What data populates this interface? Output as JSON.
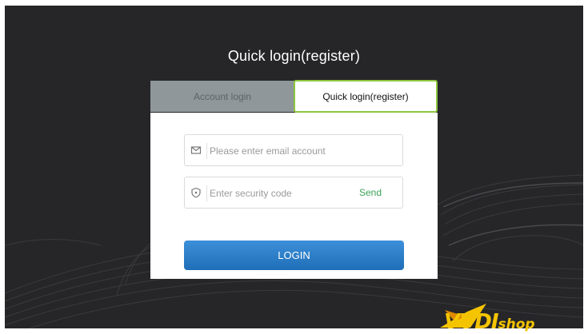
{
  "page": {
    "title": "Quick login(register)"
  },
  "tabs": [
    {
      "label": "Account login",
      "active": false
    },
    {
      "label": "Quick login(register)",
      "active": true
    }
  ],
  "form": {
    "email_placeholder": "Please enter email account",
    "email_value": "",
    "code_placeholder": "Enter security code",
    "code_value": "",
    "send_label": "Send",
    "login_label": "LOGIN"
  },
  "watermark": {
    "brand": "VVDI",
    "suffix": "shop"
  },
  "icons": {
    "email": "mail-icon",
    "code": "shield-icon"
  },
  "colors": {
    "background": "#262628",
    "tab_inactive": "#8f979a",
    "tab_active_border": "#8cc63f",
    "send_link": "#3aa357",
    "login_button": "#2a7cc7",
    "watermark": "#f5c400"
  }
}
